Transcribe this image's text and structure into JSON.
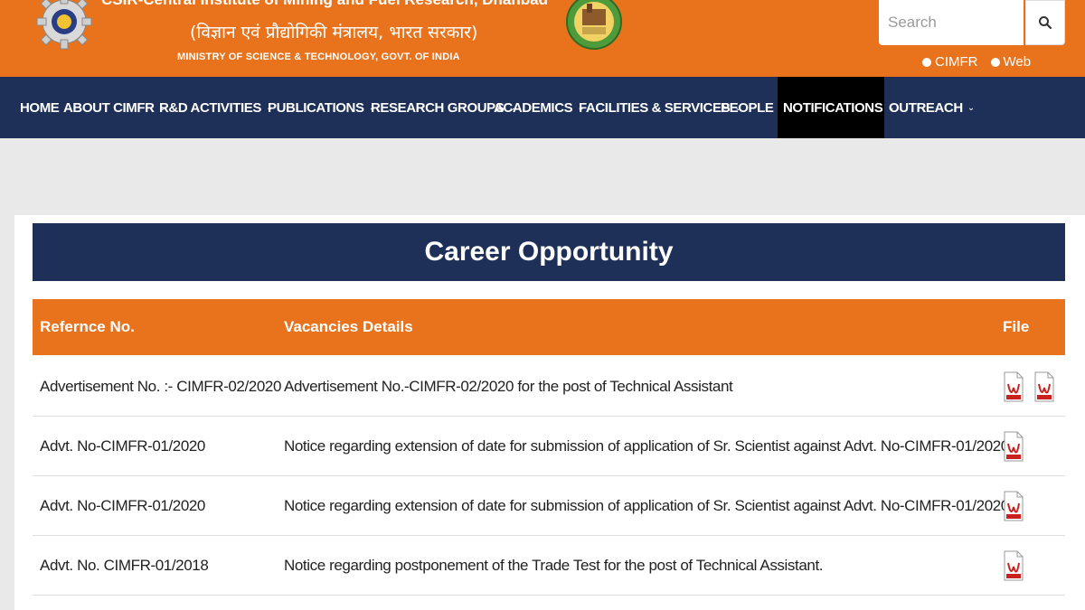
{
  "header": {
    "org_name": "CSIR-Central Institute of Mining and Fuel Research, Dhanbad",
    "org_hindi": "(विज्ञान एवं प्रौद्योगिकी मंत्रालय, भारत सरकार)",
    "ministry": "MINISTRY OF SCIENCE & TECHNOLOGY, GOVT. OF INDIA",
    "search_placeholder": "Search",
    "search_scope": [
      {
        "label": "CIMFR",
        "selected": true
      },
      {
        "label": "Web",
        "selected": false
      }
    ]
  },
  "nav": {
    "items": [
      {
        "label": "HOME",
        "has_dropdown": false
      },
      {
        "label": "ABOUT CIMFR",
        "has_dropdown": true
      },
      {
        "label": "R&D ACTIVITIES",
        "has_dropdown": true
      },
      {
        "label": "PUBLICATIONS",
        "has_dropdown": true
      },
      {
        "label": "RESEARCH GROUPS",
        "has_dropdown": true
      },
      {
        "label": "ACADEMICS",
        "has_dropdown": true
      },
      {
        "label": "FACILITIES & SERVICES",
        "has_dropdown": true
      },
      {
        "label": "PEOPLE",
        "has_dropdown": true
      },
      {
        "label": "NOTIFICATIONS",
        "has_dropdown": true,
        "active": true
      },
      {
        "label": "OUTREACH",
        "has_dropdown": true
      }
    ]
  },
  "main": {
    "title": "Career Opportunity",
    "table": {
      "columns": [
        "Refernce No.",
        "Vacancies Details",
        "File"
      ],
      "rows": [
        {
          "ref": "Advertisement No. :- CIMFR-02/2020",
          "details": "Advertisement No.-CIMFR-02/2020 for the post of Technical Assistant",
          "files": 2
        },
        {
          "ref": "Advt. No-CIMFR-01/2020",
          "details": "Notice regarding extension of date for submission of application of Sr. Scientist against Advt. No-CIMFR-01/2020.",
          "files": 1
        },
        {
          "ref": "Advt. No-CIMFR-01/2020",
          "details": "Notice regarding extension of date for submission of application of Sr. Scientist against Advt. No-CIMFR-01/2020.",
          "files": 1
        },
        {
          "ref": "Advt. No. CIMFR-01/2018",
          "details": "Notice regarding postponement of the Trade Test for the post of Technical Assistant.",
          "files": 1
        }
      ]
    }
  },
  "colors": {
    "header_orange": "#e8731c",
    "nav_navy": "#1e3057",
    "active_nav": "#000000",
    "pdf_red": "#c9211e"
  }
}
